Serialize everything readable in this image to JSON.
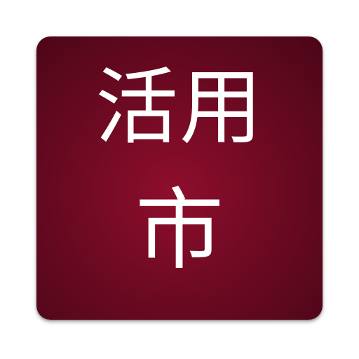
{
  "icon": {
    "line_1": "活用",
    "line_2": "市",
    "background_color": "#6f0a23",
    "text_color": "#ffffff"
  }
}
